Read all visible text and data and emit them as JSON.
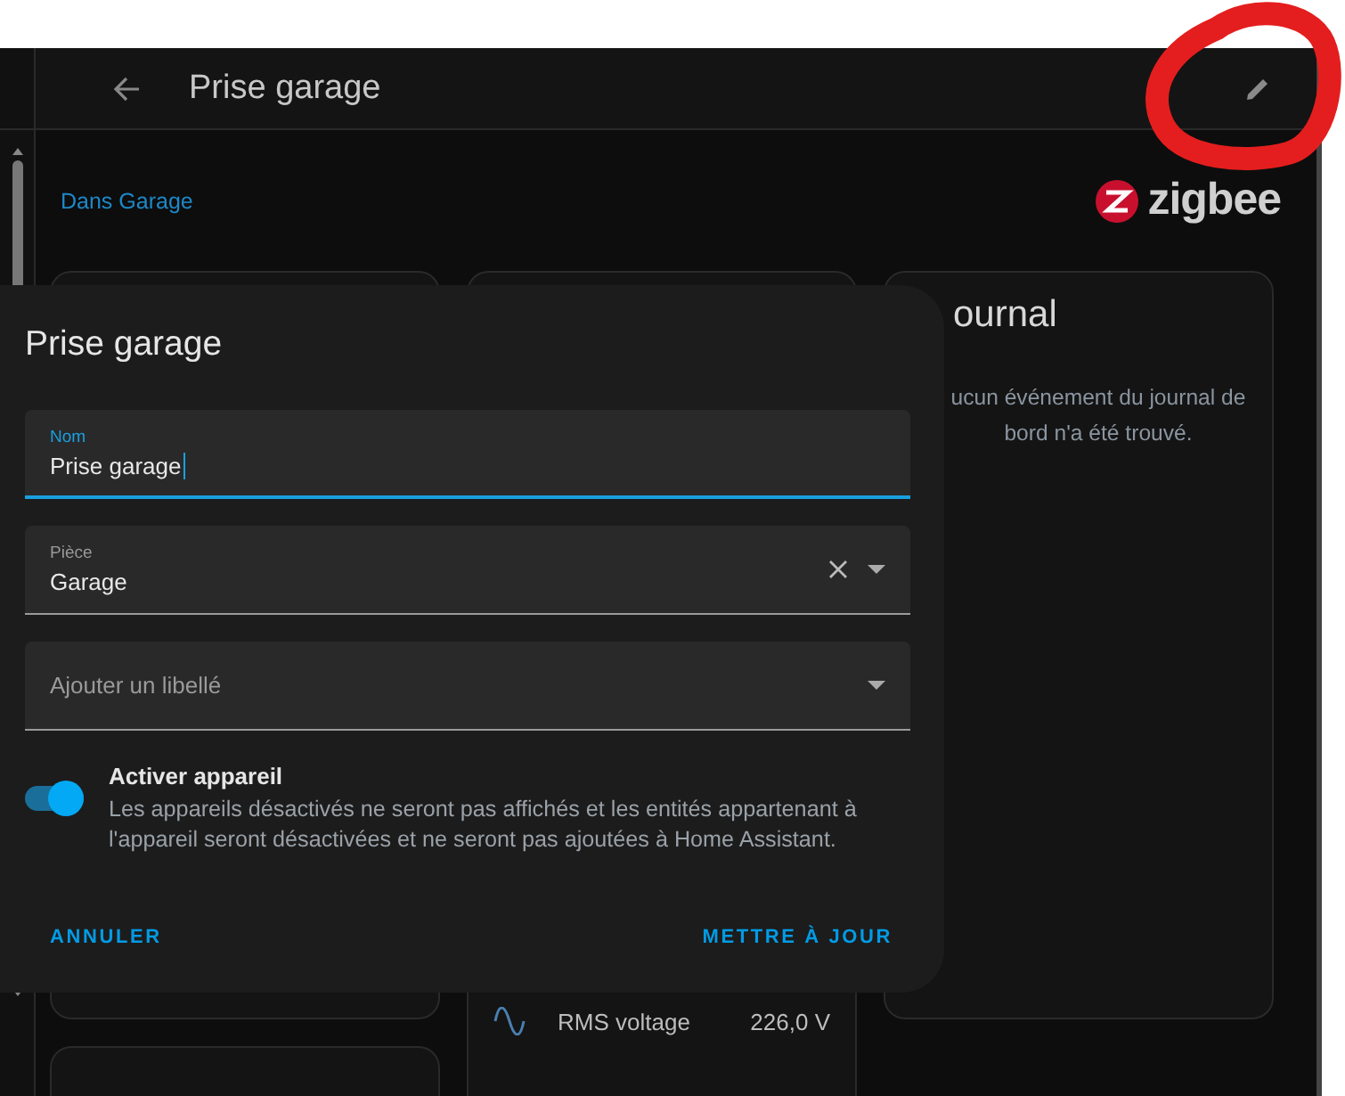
{
  "header": {
    "title": "Prise garage"
  },
  "breadcrumb": "Dans Garage",
  "integration_logo": "zigbee",
  "journal": {
    "title": "ournal",
    "message": "ucun événement du journal de bord n'a été trouvé."
  },
  "sensors": [
    {
      "name": "RMS voltage",
      "value": "226,0 V"
    }
  ],
  "dialog": {
    "title": "Prise garage",
    "fields": [
      {
        "kind": "text",
        "label": "Nom",
        "value": "Prise garage",
        "focused": true
      },
      {
        "kind": "select",
        "label": "Pièce",
        "value": "Garage",
        "clearable": true,
        "focused": false
      },
      {
        "kind": "select",
        "placeholder": "Ajouter un libellé",
        "clearable": false,
        "focused": false
      }
    ],
    "toggle": {
      "label": "Activer appareil",
      "description": "Les appareils désactivés ne seront pas affichés et les entités appartenant à l'appareil seront désactivées et ne seront pas ajoutées à Home Assistant.",
      "on": true
    },
    "buttons": [
      "ANNULER",
      "METTRE À JOUR"
    ]
  }
}
